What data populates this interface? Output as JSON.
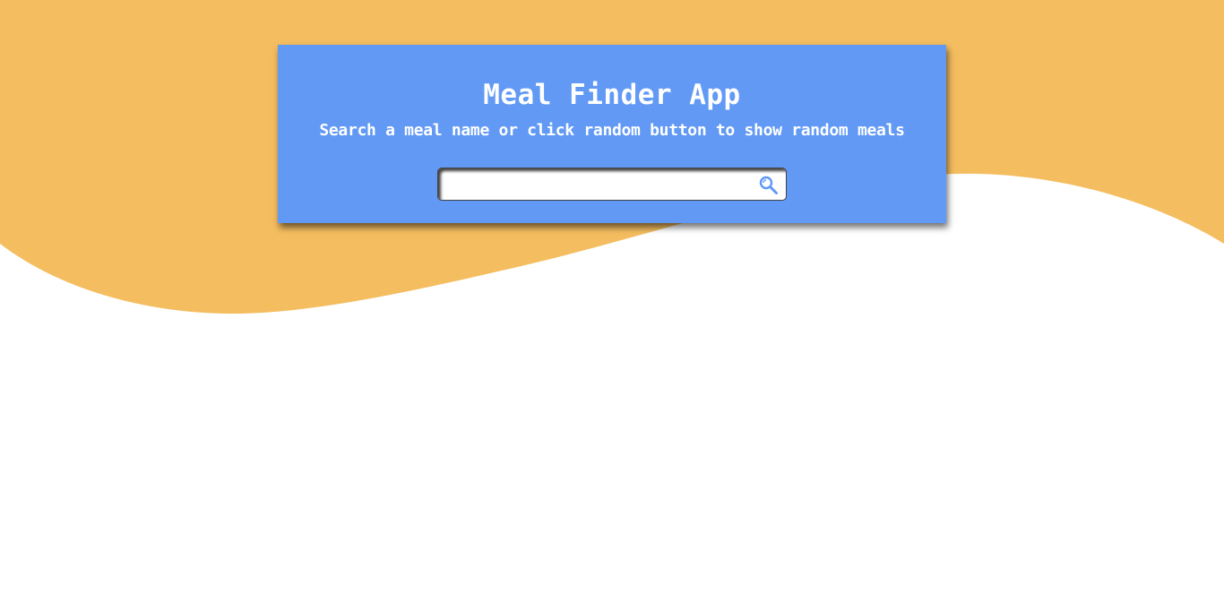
{
  "header": {
    "title": "Meal Finder App",
    "subtitle": "Search a meal name or click random button to show random meals"
  },
  "search": {
    "value": "",
    "placeholder": "",
    "button_icon": "search-icon"
  },
  "colors": {
    "background_wave": "#f4bd5f",
    "page_background": "#ffffff",
    "card_background": "#6199f5",
    "text": "#ffffff",
    "search_icon": "#6199f5"
  }
}
